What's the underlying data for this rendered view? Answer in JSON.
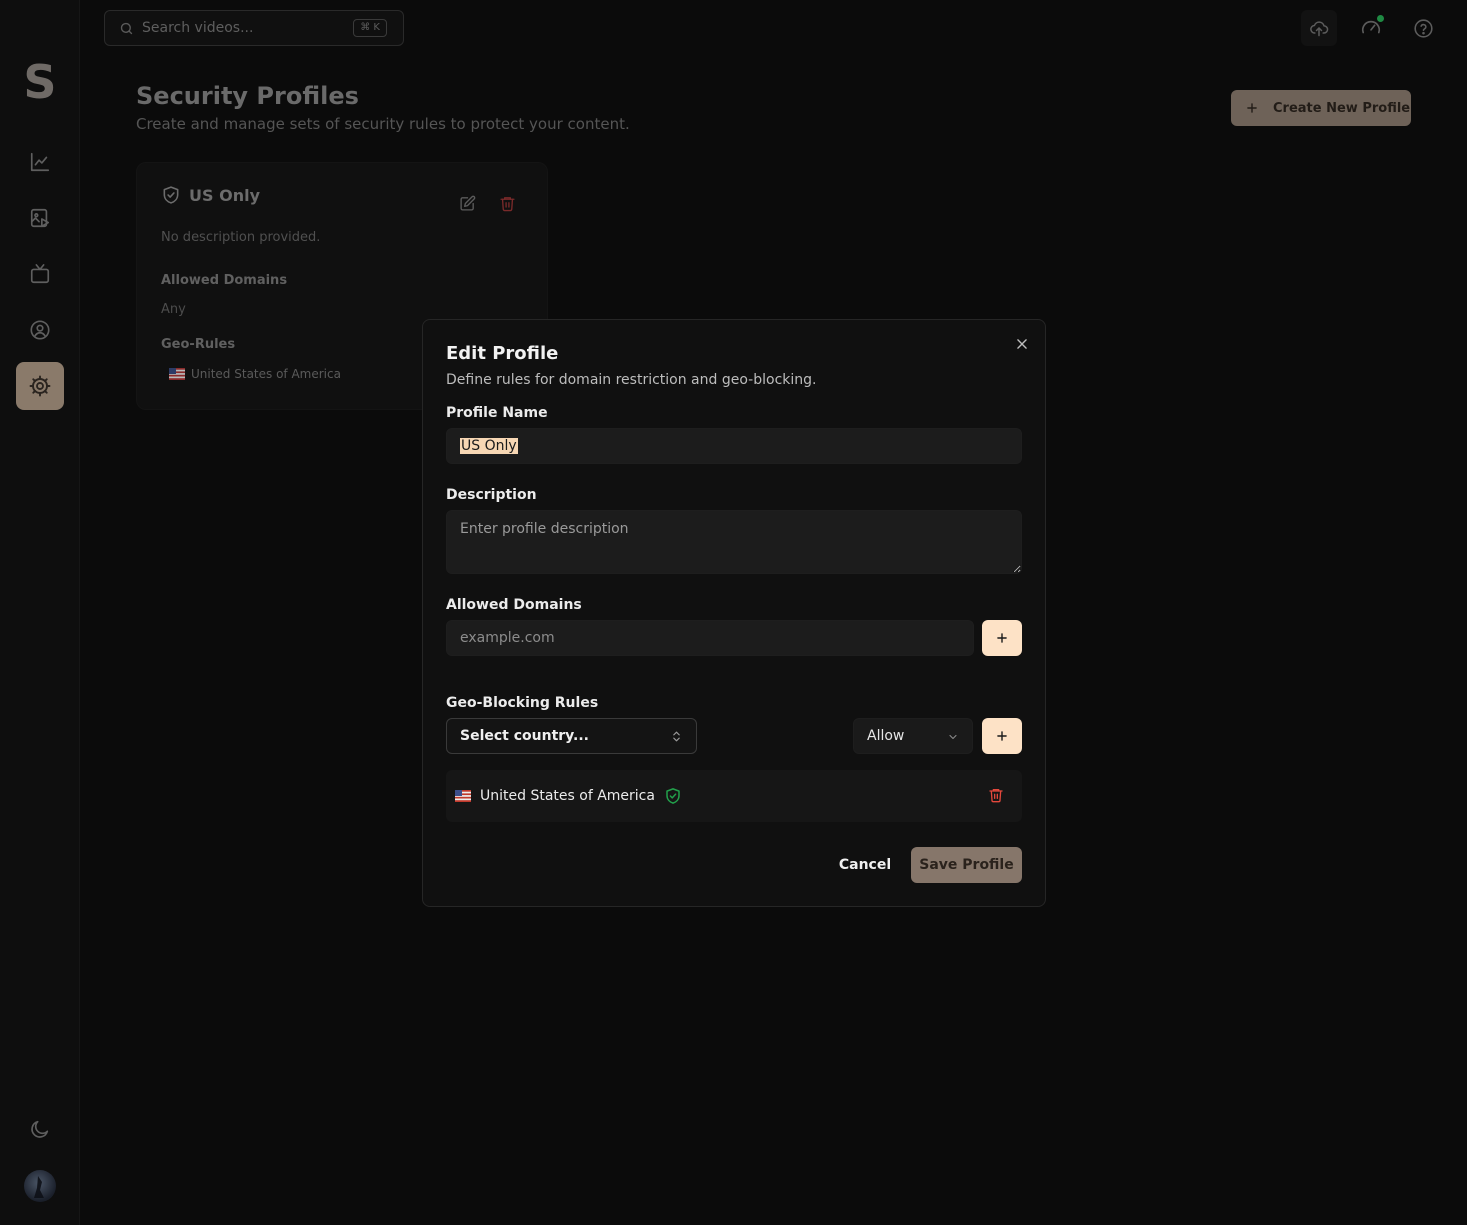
{
  "sidebar": {
    "logo_letter": "S",
    "items": [
      {
        "name": "analytics",
        "icon": "chart-line-icon"
      },
      {
        "name": "videos",
        "icon": "video-file-icon"
      },
      {
        "name": "channels",
        "icon": "tv-icon"
      },
      {
        "name": "account",
        "icon": "user-circle-icon"
      },
      {
        "name": "settings",
        "icon": "gear-icon",
        "active": true
      }
    ],
    "theme_icon": "moon-icon"
  },
  "topbar": {
    "search_placeholder": "Search videos...",
    "shortcut": "⌘ K"
  },
  "page": {
    "title": "Security Profiles",
    "subtitle": "Create and manage sets of security rules to protect your content.",
    "create_button": "Create New Profile"
  },
  "profile_card": {
    "name": "US Only",
    "description": "No description provided.",
    "allowed_domains_label": "Allowed Domains",
    "allowed_domains_value": "Any",
    "geo_rules_label": "Geo-Rules",
    "geo_rules": [
      {
        "country": "United States of America"
      }
    ]
  },
  "modal": {
    "title": "Edit Profile",
    "description": "Define rules for domain restriction and geo-blocking.",
    "profile_name_label": "Profile Name",
    "profile_name_value": "US Only",
    "description_label": "Description",
    "description_placeholder": "Enter profile description",
    "allowed_domains_label": "Allowed Domains",
    "domain_placeholder": "example.com",
    "geo_label": "Geo-Blocking Rules",
    "country_select_value": "Select country...",
    "action_select_value": "Allow",
    "rules": [
      {
        "country": "United States of America",
        "action": "allow"
      }
    ],
    "cancel_label": "Cancel",
    "save_label": "Save Profile"
  },
  "colors": {
    "accent": "#fde2c6",
    "primary_button": "#86766a",
    "danger": "#e3483c",
    "success": "#22a04b"
  }
}
